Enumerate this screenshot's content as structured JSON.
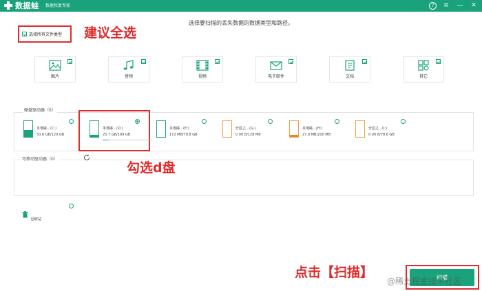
{
  "app": {
    "name": "数据蛙",
    "subtitle": "数据恢复专家"
  },
  "titlebar": {
    "help_glyph": "?",
    "menu_glyph": "≡",
    "minimize_glyph": "—",
    "close_glyph": "✕"
  },
  "instruction": "选择要扫描的丢失数据的数据类型和路径。",
  "select_all": {
    "label": "选择所有文件类型",
    "checked": true
  },
  "annotations": {
    "select_all_hint": "建议全选",
    "drive_hint": "勾选d盘",
    "scan_hint": "点击【扫描】"
  },
  "file_types": [
    {
      "label": "图片",
      "icon": "image-icon",
      "checked": true
    },
    {
      "label": "音频",
      "icon": "music-icon",
      "checked": true
    },
    {
      "label": "视频",
      "icon": "film-icon",
      "checked": true
    },
    {
      "label": "电子邮件",
      "icon": "mail-icon",
      "checked": true
    },
    {
      "label": "文档",
      "icon": "document-icon",
      "checked": true
    },
    {
      "label": "其它",
      "icon": "other-icon",
      "checked": true
    }
  ],
  "hard_drives": {
    "title": "硬盘驱动器（6）",
    "drives": [
      {
        "name": "本地磁…(C:)",
        "size": "50.6 GB/120 GB",
        "used_fraction": 0.42,
        "selected": false,
        "type": "local"
      },
      {
        "name": "本地磁…(D:)",
        "size": "25.7 GB/199 GB",
        "used_fraction": 0.13,
        "selected": true,
        "type": "local"
      },
      {
        "name": "本地磁…(E:)",
        "size": "172 MB/78.8 GB",
        "used_fraction": 0.0,
        "selected": false,
        "type": "local"
      },
      {
        "name": "分区之…(G:)",
        "size": "0.00 B/128 MB",
        "used_fraction": 0.0,
        "selected": false,
        "type": "partition"
      },
      {
        "name": "本地磁…(H:)",
        "size": "27.0 MB/200 MB",
        "used_fraction": 0.13,
        "selected": false,
        "type": "partition"
      },
      {
        "name": "分区之…(I:)",
        "size": "0.00 B/78.6 GB",
        "used_fraction": 0.0,
        "selected": false,
        "type": "partition"
      }
    ]
  },
  "removable": {
    "title": "可移动驱动器（0）"
  },
  "recycle_bin": {
    "label": "回收站"
  },
  "scan_button": {
    "label": "扫描"
  },
  "watermark": "@稀土掘金技术社区",
  "colors": {
    "brand": "#1aa37a",
    "annotation": "#e02b2b",
    "partition": "#e68a1e"
  }
}
